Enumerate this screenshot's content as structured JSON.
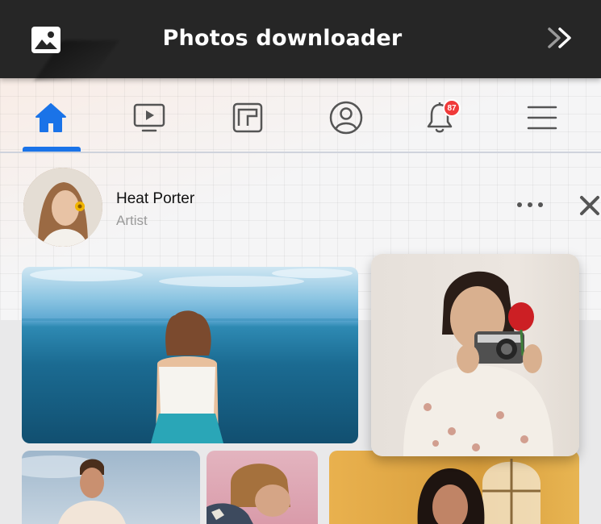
{
  "app": {
    "title": "Photos downloader",
    "icons": {
      "app": "image-icon",
      "forward": "double-chevron-right-icon"
    }
  },
  "nav": {
    "items": [
      {
        "name": "home",
        "icon": "home-icon",
        "active": true
      },
      {
        "name": "watch",
        "icon": "video-play-icon",
        "active": false
      },
      {
        "name": "pages",
        "icon": "pages-icon",
        "active": false
      },
      {
        "name": "profile",
        "icon": "user-circle-icon",
        "active": false
      },
      {
        "name": "notifications",
        "icon": "bell-icon",
        "active": false,
        "badge": "87"
      },
      {
        "name": "menu",
        "icon": "hamburger-menu-icon",
        "active": false
      }
    ],
    "accent_color": "#1a73e8",
    "badge_color": "#f03a3a"
  },
  "post": {
    "author_name": "Heat Porter",
    "author_role": "Artist",
    "icons": {
      "more": "more-dots-icon",
      "close": "close-icon"
    }
  },
  "photos": [
    {
      "subject": "woman looking at the sea"
    },
    {
      "subject": "woman holding a camera and a rose"
    },
    {
      "subject": "man under a blue sky"
    },
    {
      "subject": "person covering face with hand"
    },
    {
      "subject": "woman by an arched window"
    }
  ],
  "colors": {
    "titlebar": "#262626",
    "icon_gray": "#555555"
  }
}
